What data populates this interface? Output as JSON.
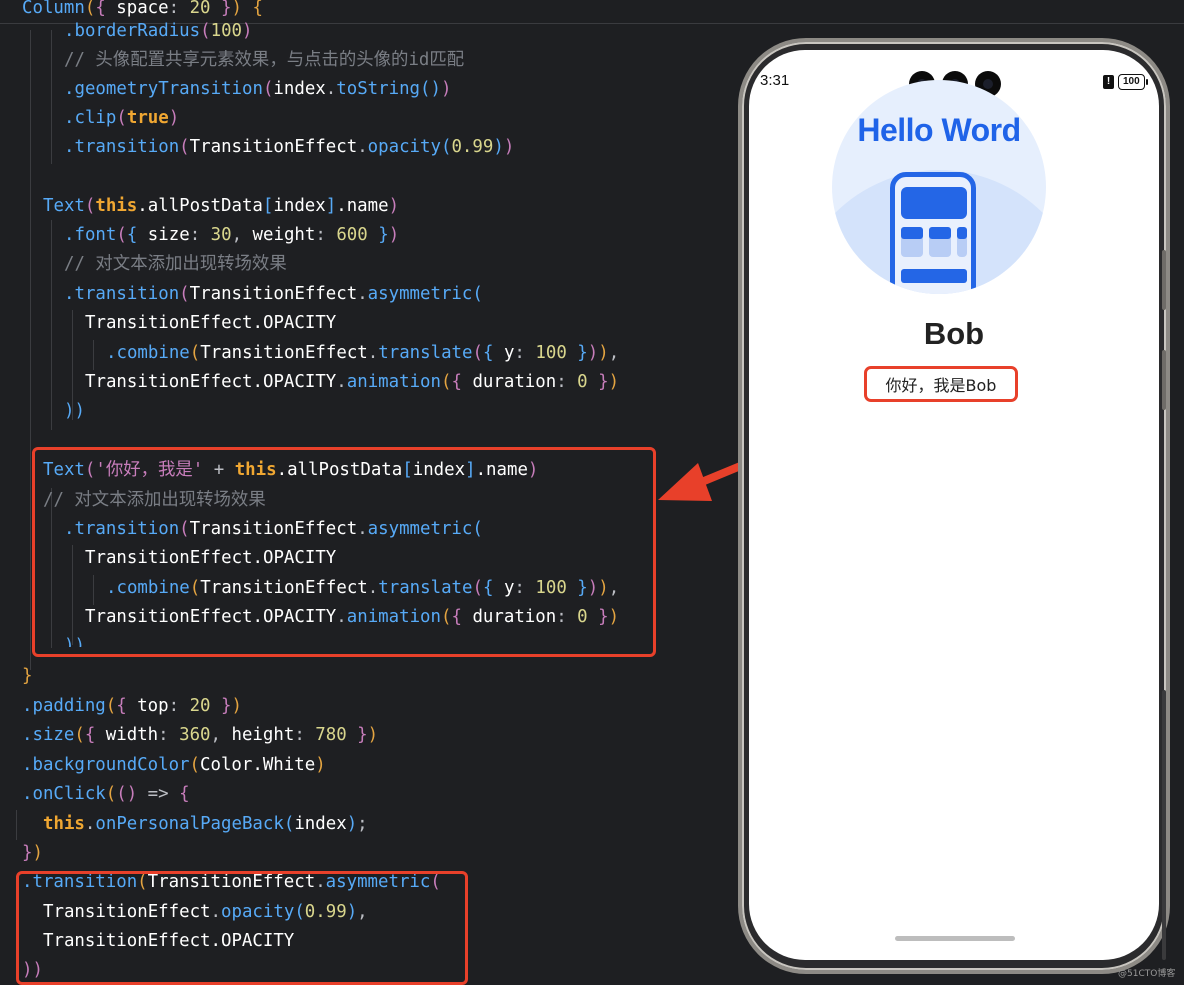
{
  "code": {
    "l01": {
      "a": "Column",
      "b": "(",
      "c": "{",
      "d": " space",
      "e": ":",
      "f": " 20",
      "g": " }",
      "h": ")",
      "i": " {"
    },
    "l02": {
      "a": ".borderRadius",
      "b": "(",
      "c": "100",
      "d": ")"
    },
    "l03": {
      "a": "// 头像配置共享元素效果，与点击的头像的id匹配"
    },
    "l04": {
      "a": ".geometryTransition",
      "b": "(",
      "c": "index",
      "d": ".",
      "e": "toString",
      "f": "()",
      "g": ")"
    },
    "l05": {
      "a": ".clip",
      "b": "(",
      "c": "true",
      "d": ")"
    },
    "l06": {
      "a": ".transition",
      "b": "(",
      "c": "TransitionEffect",
      "d": ".",
      "e": "opacity",
      "f": "(",
      "g": "0.99",
      "h": ")",
      "i": ")"
    },
    "l08": {
      "a": "Text",
      "b": "(",
      "c": "this",
      "d": ".allPostData",
      "e": "[",
      "f": "index",
      "g": "]",
      "h": ".name",
      "i": ")"
    },
    "l09": {
      "a": ".font",
      "b": "(",
      "c": "{",
      "d": " size",
      "e": ":",
      "f": " 30",
      "g": ",",
      "h": " weight",
      "i": ":",
      "j": " 600",
      "k": " }",
      "l": ")"
    },
    "l10": {
      "a": "// 对文本添加出现转场效果"
    },
    "l11": {
      "a": ".transition",
      "b": "(",
      "c": "TransitionEffect",
      "d": ".",
      "e": "asymmetric",
      "f": "("
    },
    "l12": {
      "a": "TransitionEffect.OPACITY"
    },
    "l13": {
      "a": ".combine",
      "b": "(",
      "c": "TransitionEffect",
      "d": ".",
      "e": "translate",
      "f": "(",
      "g": "{",
      "h": " y",
      "i": ":",
      "j": " 100",
      "k": " }",
      "l": ")",
      "m": ")",
      "n": ","
    },
    "l14": {
      "a": "TransitionEffect.OPACITY",
      "b": ".",
      "c": "animation",
      "d": "(",
      "e": "{",
      "f": " duration",
      "g": ":",
      "h": " 0",
      "i": " }",
      "j": ")"
    },
    "l15": {
      "a": "))"
    },
    "l17": {
      "a": "Text",
      "b": "(",
      "c": "'你好，我是'",
      "d": " + ",
      "e": "this",
      "f": ".allPostData",
      "g": "[",
      "h": "index",
      "i": "]",
      "j": ".name",
      "k": ")"
    },
    "l18": {
      "a": "// 对文本添加出现转场效果"
    },
    "l19": {
      "a": ".transition",
      "b": "(",
      "c": "TransitionEffect",
      "d": ".",
      "e": "asymmetric",
      "f": "("
    },
    "l20": {
      "a": "TransitionEffect.OPACITY"
    },
    "l21": {
      "a": ".combine",
      "b": "(",
      "c": "TransitionEffect",
      "d": ".",
      "e": "translate",
      "f": "(",
      "g": "{",
      "h": " y",
      "i": ":",
      "j": " 100",
      "k": " }",
      "l": ")",
      "m": ")",
      "n": ","
    },
    "l22": {
      "a": "TransitionEffect.OPACITY",
      "b": ".",
      "c": "animation",
      "d": "(",
      "e": "{",
      "f": " duration",
      "g": ":",
      "h": " 0",
      "i": " }",
      "j": ")"
    },
    "l23": {
      "a": "))"
    },
    "l24": {
      "a": "}"
    },
    "l25": {
      "a": ".padding",
      "b": "(",
      "c": "{",
      "d": " top",
      "e": ":",
      "f": " 20",
      "g": " }",
      "h": ")"
    },
    "l26": {
      "a": ".size",
      "b": "(",
      "c": "{",
      "d": " width",
      "e": ":",
      "f": " 360",
      "g": ",",
      "h": " height",
      "i": ":",
      "j": " 780",
      "k": " }",
      "l": ")"
    },
    "l27": {
      "a": ".backgroundColor",
      "b": "(",
      "c": "Color.White",
      "d": ")"
    },
    "l28": {
      "a": ".onClick",
      "b": "(",
      "c": "()",
      "d": " => ",
      "e": "{"
    },
    "l29": {
      "a": "this",
      "b": ".",
      "c": "onPersonalPageBack",
      "d": "(",
      "e": "index",
      "f": ")",
      "g": ";"
    },
    "l30": {
      "a": "}",
      "b": ")"
    },
    "l31": {
      "a": ".transition",
      "b": "(",
      "c": "TransitionEffect",
      "d": ".",
      "e": "asymmetric",
      "f": "("
    },
    "l32": {
      "a": "TransitionEffect",
      "b": ".",
      "c": "opacity",
      "d": "(",
      "e": "0.99",
      "f": ")",
      "g": ","
    },
    "l33": {
      "a": "TransitionEffect.OPACITY"
    },
    "l34": {
      "a": "))"
    }
  },
  "phone": {
    "time": "3:31",
    "alert": "!",
    "battery": "100",
    "avatar_title": "Hello Word",
    "name": "Bob",
    "greeting": "你好，我是Bob"
  },
  "watermark": "@51CTO博客",
  "colors": {
    "highlight": "#e8402a",
    "editor_bg": "#1e1f22",
    "accent_blue": "#1f63e8"
  }
}
